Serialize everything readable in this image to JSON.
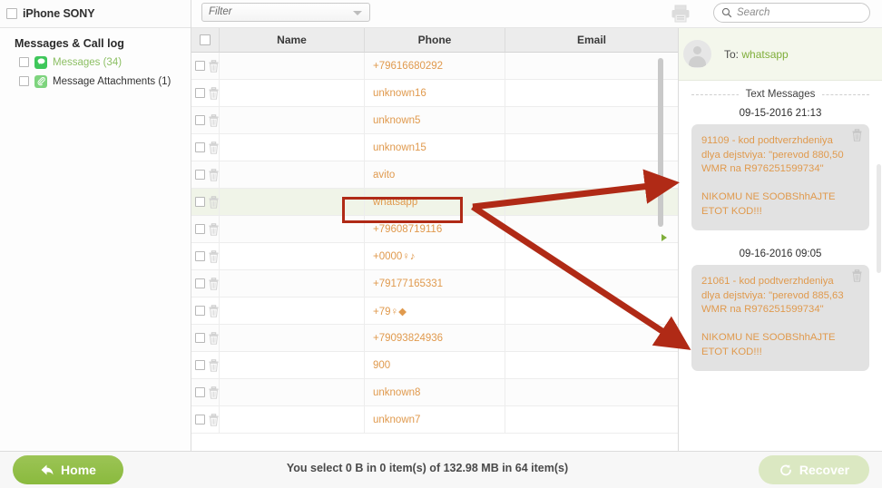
{
  "colors": {
    "accent_green": "#8aba3e",
    "phone_orange": "#e09a4e",
    "annotation_red": "#b02a16",
    "selected_row": "#f0f4e8"
  },
  "sidebar": {
    "device_name": "iPhone SONY",
    "group_title": "Messages & Call log",
    "items": [
      {
        "label": "Messages (34)",
        "icon": "message-bubble-icon",
        "selected": true
      },
      {
        "label": "Message Attachments (1)",
        "icon": "paperclip-icon",
        "selected": false
      }
    ]
  },
  "toolbar": {
    "filter_value": "Filter",
    "filter_placeholder": "Filter",
    "printer_icon": "printer-icon",
    "search_placeholder": "Search",
    "search_value": ""
  },
  "table": {
    "columns": [
      "",
      "Name",
      "Phone",
      "Email"
    ],
    "rows": [
      {
        "name": "",
        "phone": "+79616680292",
        "email": "",
        "selected": false
      },
      {
        "name": "",
        "phone": "unknown16",
        "email": "",
        "selected": false
      },
      {
        "name": "",
        "phone": "unknown5",
        "email": "",
        "selected": false
      },
      {
        "name": "",
        "phone": "unknown15",
        "email": "",
        "selected": false
      },
      {
        "name": "",
        "phone": "avito",
        "email": "",
        "selected": false
      },
      {
        "name": "",
        "phone": "whatsapp",
        "email": "",
        "selected": true
      },
      {
        "name": "",
        "phone": "+79608719116",
        "email": "",
        "selected": false
      },
      {
        "name": "",
        "phone": "+0000♀♪",
        "email": "",
        "selected": false
      },
      {
        "name": "",
        "phone": "+79177165331",
        "email": "",
        "selected": false
      },
      {
        "name": "",
        "phone": "+79♀◆",
        "email": "",
        "selected": false
      },
      {
        "name": "",
        "phone": "+79093824936",
        "email": "",
        "selected": false
      },
      {
        "name": "",
        "phone": "900",
        "email": "",
        "selected": false
      },
      {
        "name": "",
        "phone": "unknown8",
        "email": "",
        "selected": false
      },
      {
        "name": "",
        "phone": "unknown7",
        "email": "",
        "selected": false
      }
    ]
  },
  "detail": {
    "to_label": "To:",
    "to_name": "whatsapp",
    "section_label": "Text Messages",
    "messages": [
      {
        "date": "09-15-2016 21:13",
        "body": "91109 - kod podtverzhdeniya dlya dejstviya: \"perevod 880,50 WMR na R976251599734\"\n\nNIKOMU NE SOOBShhAJTE ETOT KOD!!!"
      },
      {
        "date": "09-16-2016 09:05",
        "body": "21061 - kod podtverzhdeniya dlya dejstviya: \"perevod 885,63 WMR na R976251599734\"\n\nNIKOMU NE SOOBShhAJTE ETOT KOD!!!"
      }
    ]
  },
  "bottombar": {
    "home_label": "Home",
    "recover_label": "Recover",
    "status": "You select 0 B in 0 item(s) of 132.98 MB in 64 item(s)"
  }
}
